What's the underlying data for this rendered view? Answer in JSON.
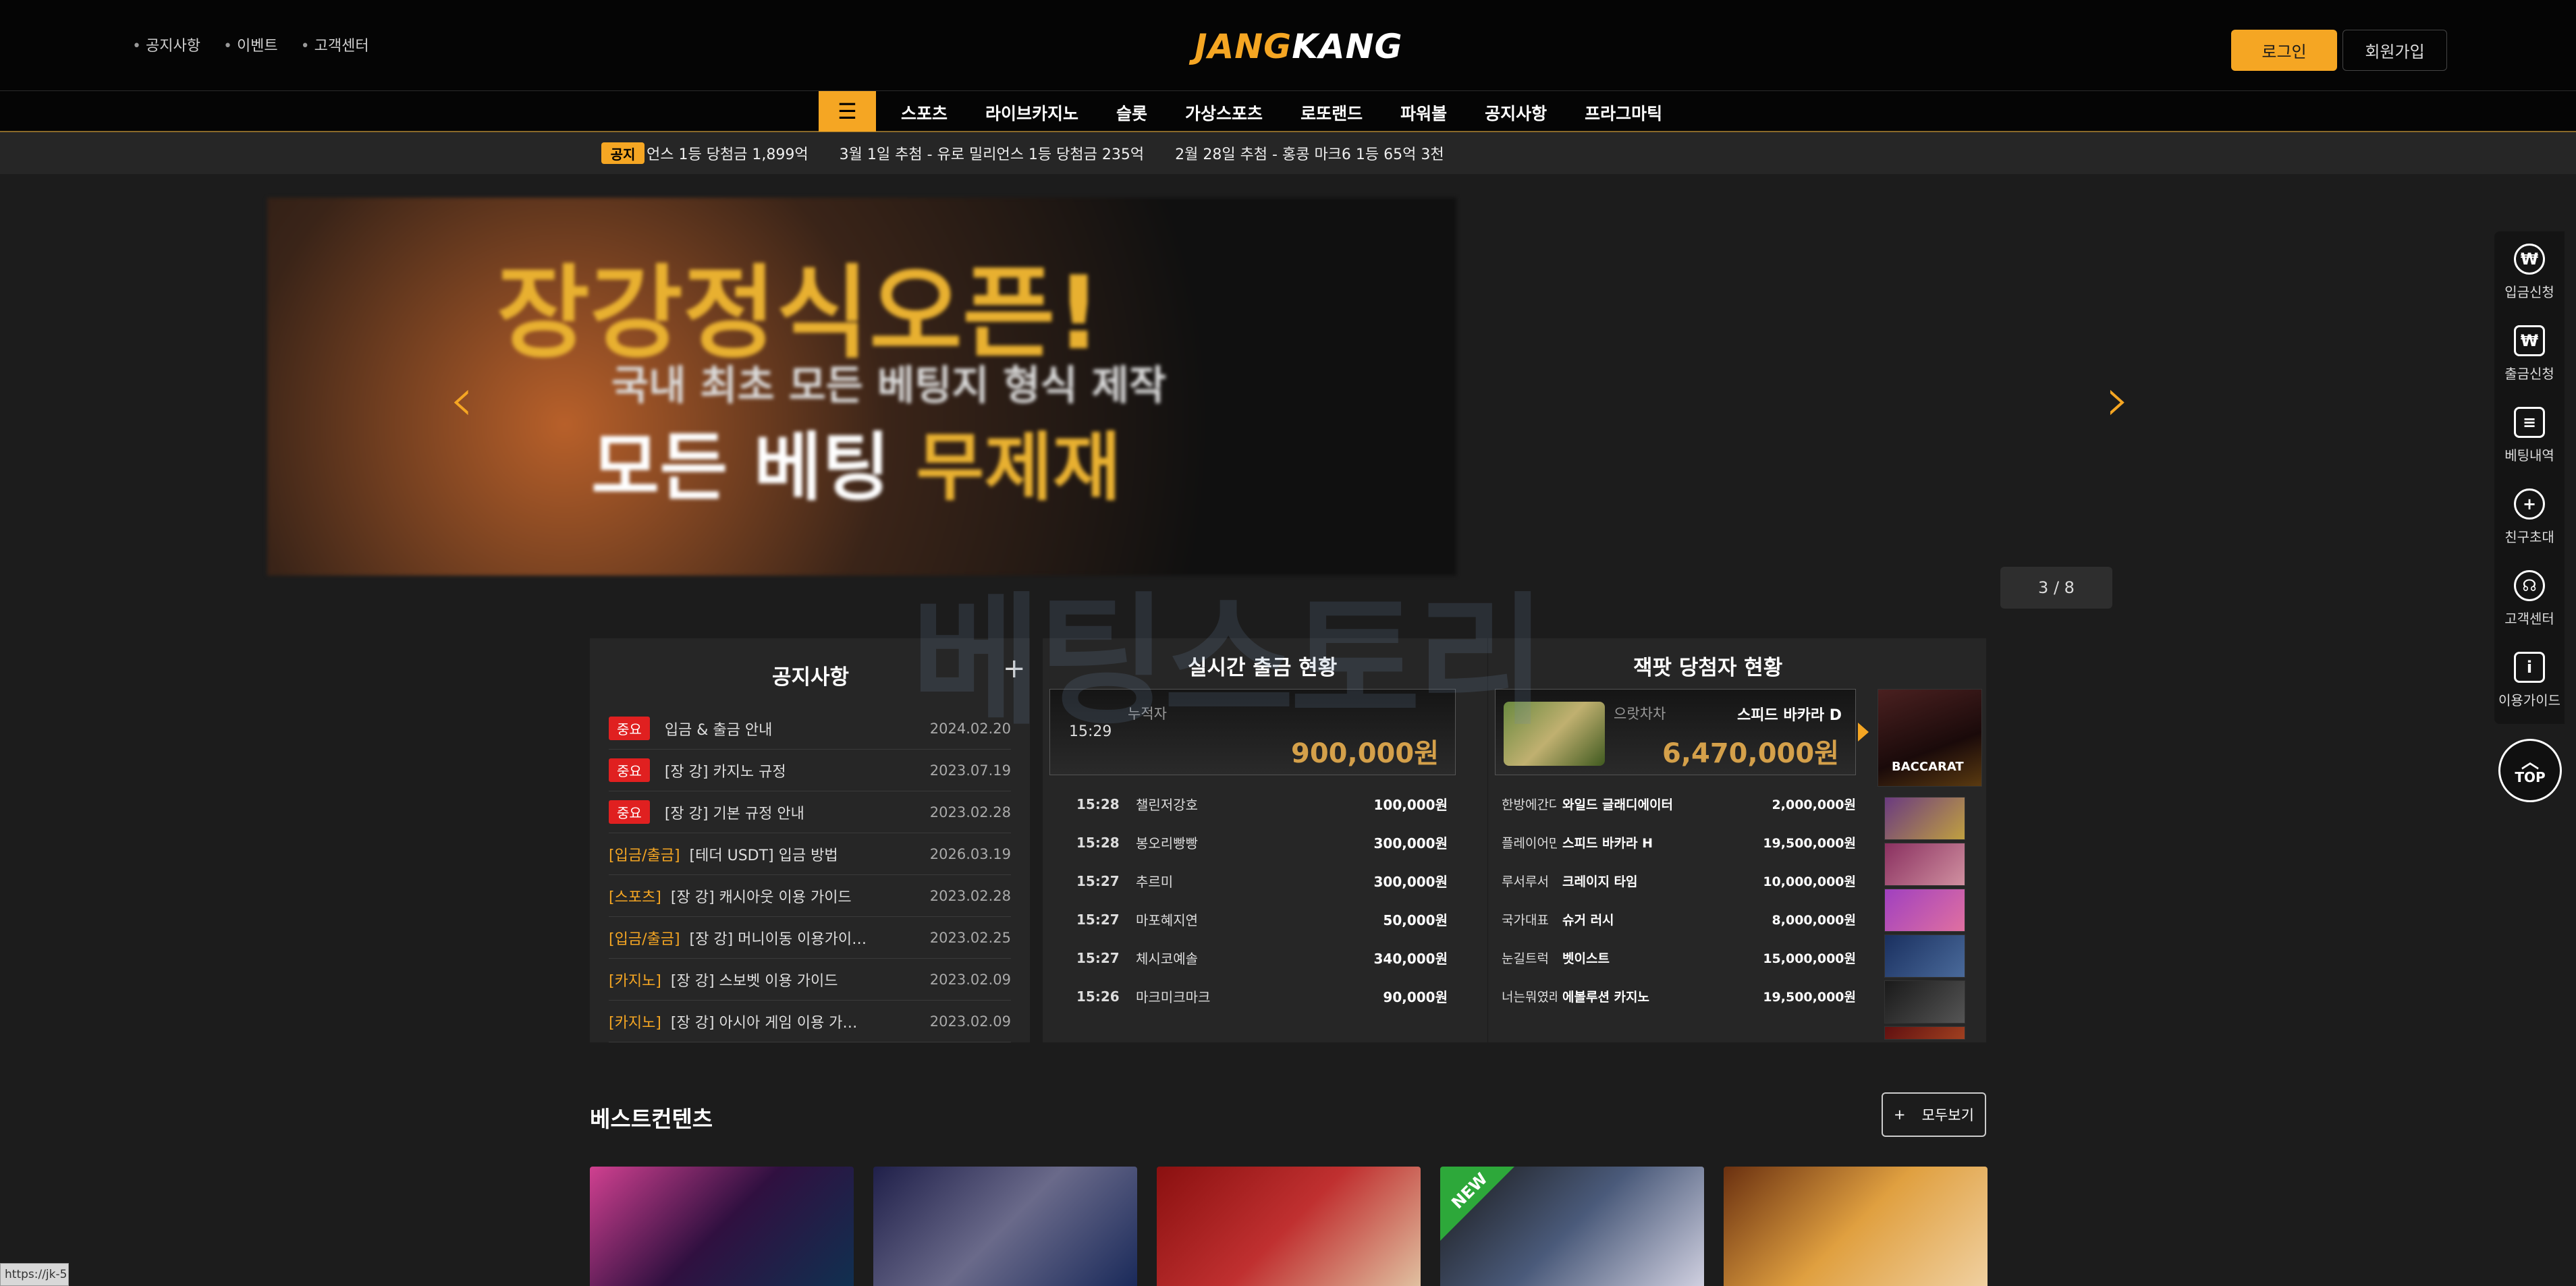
{
  "header": {
    "links": [
      "공지사항",
      "이벤트",
      "고객센터"
    ],
    "logo_left": "JANG",
    "logo_right": "KANG",
    "login": "로그인",
    "join": "회원가입"
  },
  "nav": {
    "menu_icon": "☰",
    "items": [
      "스포츠",
      "라이브카지노",
      "슬롯",
      "가상스포츠",
      "로또랜드",
      "파워볼",
      "공지사항",
      "프라그마틱"
    ]
  },
  "ticker": {
    "badge": "공지",
    "messages": [
      "언스 1등 당첨금 1,899억",
      "3월 1일 추첨 - 유로 밀리언스 1등 당첨금 235억",
      "2월 28일 추첨 - 홍콩 마크6 1등 65억 3천"
    ]
  },
  "banner": {
    "headline": "장강정식오픈!",
    "sub": "국내 최초 모든 베팅지 형식 제작",
    "bottom_a": "모든 베팅",
    "bottom_b": "무제재",
    "prev_icon": "‹",
    "next_icon": "›",
    "counter": "3 / 8"
  },
  "watermark": "베팅스토리",
  "notice": {
    "title": "공지사항",
    "plus": "+",
    "rows": [
      {
        "tag": "중요",
        "tag_type": "red",
        "title": "입금 & 출금 안내",
        "date": "2024.02.20"
      },
      {
        "tag": "중요",
        "tag_type": "red",
        "title": "[장 강] 카지노 규정",
        "date": "2023.07.19"
      },
      {
        "tag": "중요",
        "tag_type": "red",
        "title": "[장 강] 기본 규정 안내",
        "date": "2023.02.28"
      },
      {
        "tag": "[입금/출금]",
        "tag_type": "cat",
        "title": "[테더 USDT] 입금 방법",
        "date": "2026.03.19"
      },
      {
        "tag": "[스포츠]",
        "tag_type": "cat",
        "title": "[장 강] 캐시아웃 이용 가이드",
        "date": "2023.02.28"
      },
      {
        "tag": "[입금/출금]",
        "tag_type": "cat",
        "title": "[장 강] 머니이동 이용가이…",
        "date": "2023.02.25"
      },
      {
        "tag": "[카지노]",
        "tag_type": "cat",
        "title": "[장 강] 스보벳 이용 가이드",
        "date": "2023.02.09"
      },
      {
        "tag": "[카지노]",
        "tag_type": "cat",
        "title": "[장 강] 아시아 게임 이용 가…",
        "date": "2023.02.09"
      }
    ]
  },
  "withdraw": {
    "title": "실시간 출금 현황",
    "total_label": "누적자",
    "total_time": "15:29",
    "total_amount": "900,000원",
    "rows": [
      {
        "time": "15:28",
        "name": "챌린저강호",
        "amount": "100,000원"
      },
      {
        "time": "15:28",
        "name": "봉오리빵빵",
        "amount": "300,000원"
      },
      {
        "time": "15:27",
        "name": "추르미",
        "amount": "300,000원"
      },
      {
        "time": "15:27",
        "name": "마포혜지연",
        "amount": "50,000원"
      },
      {
        "time": "15:27",
        "name": "체시코예솔",
        "amount": "340,000원"
      },
      {
        "time": "15:26",
        "name": "마크미크마크",
        "amount": "90,000원"
      }
    ]
  },
  "jackpot": {
    "title": "잭팟 당첨자 현황",
    "top_user": "으랏차차",
    "top_game": "스피드 바카라 D",
    "top_amount": "6,470,000원",
    "thumb_label": "BACCARAT",
    "rows": [
      {
        "user": "한방에간다",
        "game": "와일드 글래디에이터",
        "amount": "2,000,000원"
      },
      {
        "user": "플레이어만판다",
        "game": "스피드 바카라 H",
        "amount": "19,500,000원"
      },
      {
        "user": "루서루서",
        "game": "크레이지 타임",
        "amount": "10,000,000원"
      },
      {
        "user": "국가대표",
        "game": "슈거 러시",
        "amount": "8,000,000원"
      },
      {
        "user": "눈길트럭",
        "game": "벳이스트",
        "amount": "15,000,000원"
      },
      {
        "user": "너는뭐였래",
        "game": "에볼루션 카지노",
        "amount": "19,500,000원"
      }
    ]
  },
  "best": {
    "title": "베스트컨텐츠",
    "view_all_plus": "+",
    "view_all": "모두보기",
    "new_badge": "NEW"
  },
  "sidebar": {
    "items": [
      {
        "icon": "₩",
        "label": "입금신청"
      },
      {
        "icon": "₩",
        "label": "출금신청"
      },
      {
        "icon": "≡",
        "label": "베팅내역"
      },
      {
        "icon": "+",
        "label": "친구초대"
      },
      {
        "icon": "☊",
        "label": "고객센터"
      },
      {
        "icon": "i",
        "label": "이용가이드"
      }
    ],
    "top": "TOP"
  },
  "status_url": "https://jk-5"
}
